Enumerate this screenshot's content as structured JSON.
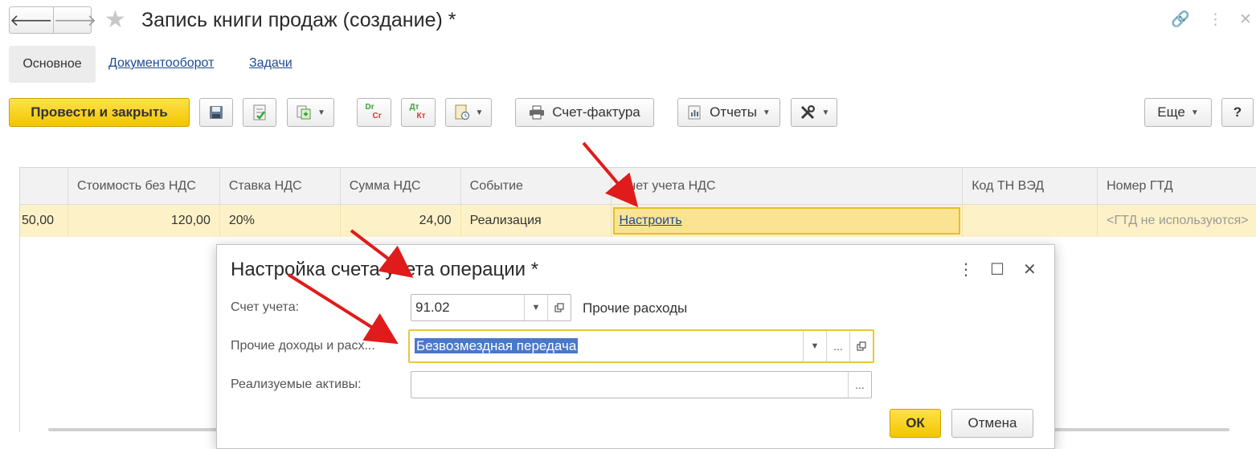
{
  "window": {
    "title": "Запись книги продаж (создание) *",
    "back_glyph": "🡐",
    "forward_glyph": "🡒",
    "star_glyph": "★",
    "link_glyph": "🔗",
    "more_glyph": "⋮",
    "close_glyph": "✕"
  },
  "tabs": {
    "main": "Основное",
    "docflow": "Документооборот",
    "tasks": "Задачи"
  },
  "toolbar": {
    "post_and_close": "Провести и закрыть",
    "dr_top": "Dr",
    "dr_bottom": "Cr",
    "dt_top": "Дт",
    "dt_bottom": "Кт",
    "invoice": "Счет-фактура",
    "reports": "Отчеты",
    "more": "Еще",
    "help": "?"
  },
  "table": {
    "columns": [
      "Стоимость без НДС",
      "Ставка НДС",
      "Сумма НДС",
      "Событие",
      "Счет учета НДС",
      "Код ТН ВЭД",
      "Номер ГТД"
    ],
    "row": {
      "partial": "50,00",
      "cost": "120,00",
      "rate": "20%",
      "vat_amount": "24,00",
      "event": "Реализация",
      "vat_account": "Настроить",
      "tn_ved": "",
      "gtd": "<ГТД не используются>"
    }
  },
  "dialog": {
    "title": "Настройка счета учета операции *",
    "more_glyph": "⋮",
    "maximize_glyph": "☐",
    "close_glyph": "✕",
    "account_label": "Счет учета:",
    "account_value": "91.02",
    "account_name": "Прочие расходы",
    "other_label": "Прочие доходы и расх...",
    "other_value": "Безвозмездная передача",
    "assets_label": "Реализуемые активы:",
    "assets_value": "",
    "ellipsis": "...",
    "ok": "ОК",
    "cancel": "Отмена"
  },
  "colors": {
    "accent_yellow": "#f2c500",
    "selected_row": "#fdf2c7",
    "link_blue": "#1d4b92",
    "annotation_red": "#e01b1b"
  }
}
